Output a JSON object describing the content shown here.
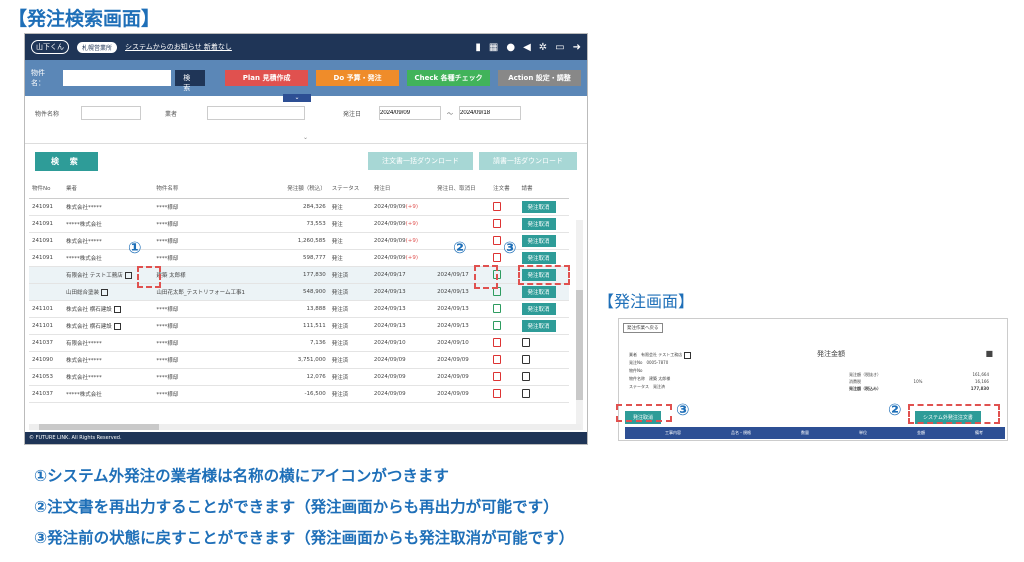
{
  "page_heading": "【発注検索画面】",
  "order_heading": "【発注画面】",
  "topbar": {
    "logo": "山下くん",
    "user": "札幌営業所",
    "notice": "システムからのお知らせ 新着なし"
  },
  "searchbar": {
    "label": "物件名：",
    "search_btn": "検索",
    "plan": "Plan 見積作成",
    "do": "Do 予算・発注",
    "check": "Check 各種チェック",
    "action": "Action 設定・調整"
  },
  "form": {
    "property_label": "物件名称",
    "vendor_label": "業者",
    "order_date_label": "発注日",
    "date_from": "2024/09/09",
    "tilde": "〜",
    "date_to": "2024/09/18"
  },
  "actions": {
    "search": "検 索",
    "download_orders": "注文書一括ダウンロード",
    "download_requests": "請書一括ダウンロード"
  },
  "table": {
    "headers": [
      "物件No",
      "業者",
      "物件名称",
      "発注額（税込）",
      "ステータス",
      "発注日",
      "発注日、取消日",
      "注文書",
      "請書"
    ],
    "rows": [
      {
        "no": "241091",
        "vendor": "株式会社*****",
        "name": "****様邸",
        "amount": "284,326",
        "status": "発注",
        "date": "2024/09/09",
        "plus": "(+9)",
        "date2": "",
        "cancel": "発注取消"
      },
      {
        "no": "241091",
        "vendor": "*****株式会社",
        "name": "****様邸",
        "amount": "73,553",
        "status": "発注",
        "date": "2024/09/09",
        "plus": "(+9)",
        "date2": "",
        "cancel": "発注取消"
      },
      {
        "no": "241091",
        "vendor": "株式会社*****",
        "name": "****様邸",
        "amount": "1,260,585",
        "status": "発注",
        "date": "2024/09/09",
        "plus": "(+9)",
        "date2": "",
        "cancel": "発注取消"
      },
      {
        "no": "241091",
        "vendor": "*****株式会社",
        "name": "****様邸",
        "amount": "598,777",
        "status": "発注",
        "date": "2024/09/09",
        "plus": "(+9)",
        "date2": "",
        "cancel": "発注取消"
      },
      {
        "no": "",
        "vendor": "有限会社 テスト工務店",
        "name": "建築 太郎様",
        "amount": "177,830",
        "status": "発注済",
        "date": "2024/09/17",
        "plus": "",
        "date2": "2024/09/17",
        "cancel": "発注取消"
      },
      {
        "no": "",
        "vendor": "山田総合塗装",
        "name": "山田花太郎_テストリフォーム工事1",
        "amount": "548,900",
        "status": "発注済",
        "date": "2024/09/13",
        "plus": "",
        "date2": "2024/09/13",
        "cancel": "発注取消"
      },
      {
        "no": "241101",
        "vendor": "株式会社 横石建設",
        "name": "****様邸",
        "amount": "13,888",
        "status": "発注済",
        "date": "2024/09/13",
        "plus": "",
        "date2": "2024/09/13",
        "cancel": "発注取消"
      },
      {
        "no": "241101",
        "vendor": "株式会社 横石建設",
        "name": "****様邸",
        "amount": "111,511",
        "status": "発注済",
        "date": "2024/09/13",
        "plus": "",
        "date2": "2024/09/13",
        "cancel": "発注取消"
      },
      {
        "no": "241037",
        "vendor": "有限会社*****",
        "name": "****様邸",
        "amount": "7,136",
        "status": "発注済",
        "date": "2024/09/10",
        "plus": "",
        "date2": "2024/09/10",
        "cancel": ""
      },
      {
        "no": "241090",
        "vendor": "株式会社*****",
        "name": "****様邸",
        "amount": "3,751,000",
        "status": "発注済",
        "date": "2024/09/09",
        "plus": "",
        "date2": "2024/09/09",
        "cancel": ""
      },
      {
        "no": "241053",
        "vendor": "株式会社*****",
        "name": "****様邸",
        "amount": "12,076",
        "status": "発注済",
        "date": "2024/09/09",
        "plus": "",
        "date2": "2024/09/09",
        "cancel": ""
      },
      {
        "no": "241037",
        "vendor": "*****株式会社",
        "name": "****様邸",
        "amount": "-16,500",
        "status": "発注済",
        "date": "2024/09/09",
        "plus": "",
        "date2": "2024/09/09",
        "cancel": ""
      }
    ]
  },
  "footer": "© FUTURE LINK. All Rights Reserved.",
  "markers": {
    "m1": "①",
    "m2": "②",
    "m3": "③"
  },
  "mini": {
    "back": "発注作業へ戻る",
    "title": "発注金額",
    "vendor_label": "業者",
    "vendor": "有限会社 テスト工務店",
    "order_no_label": "発注No",
    "order_no": "0005-7870",
    "prop_no_label": "物件No",
    "prop_label": "物件名称",
    "prop": "建築 太郎様",
    "status_label": "ステータス",
    "status": "発注済",
    "amount_ex_label": "発注額（税抜き）",
    "amount_ex": "161,664",
    "tax_label": "消費税",
    "tax_rate": "10%",
    "tax": "16,166",
    "amount_in_label": "発注額（税込み）",
    "amount_in": "177,830",
    "cancel_btn": "発注取消",
    "reissue_btn": "システム外発注注文書",
    "col_name": "工事内容",
    "col_spec": "品名・規格",
    "col_qty": "数量",
    "col_unit": "単位",
    "col_amount": "金額",
    "col_note": "備考"
  },
  "captions": [
    "①システム外発注の業者様は名称の横にアイコンがつきます",
    "②注文書を再出力することができます（発注画面からも再出力が可能です）",
    "③発注前の状態に戻すことができます（発注画面からも発注取消が可能です）"
  ]
}
